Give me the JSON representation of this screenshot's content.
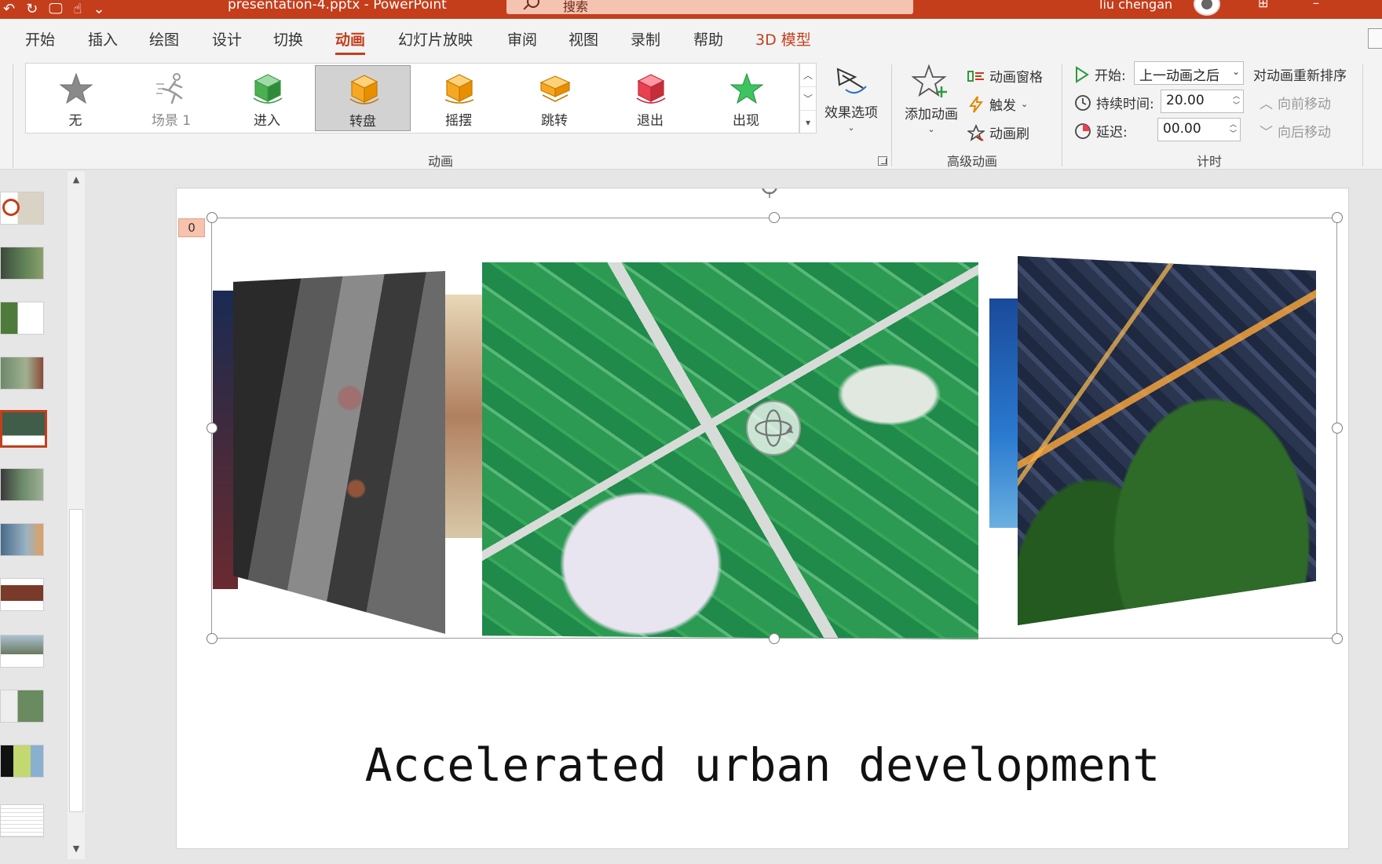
{
  "titlebar": {
    "document": "presentation-4.pptx - PowerPoint",
    "search_placeholder": "搜索",
    "user": "liu chengan"
  },
  "tabs": [
    {
      "label": "开始"
    },
    {
      "label": "插入"
    },
    {
      "label": "绘图"
    },
    {
      "label": "设计"
    },
    {
      "label": "切换"
    },
    {
      "label": "动画"
    },
    {
      "label": "幻灯片放映"
    },
    {
      "label": "审阅"
    },
    {
      "label": "视图"
    },
    {
      "label": "录制"
    },
    {
      "label": "帮助"
    },
    {
      "label": "3D 模型"
    }
  ],
  "animations": {
    "group_label": "动画",
    "items": [
      {
        "label": "无",
        "icon": "star-icon"
      },
      {
        "label": "场景 1",
        "icon": "running-person-icon"
      },
      {
        "label": "进入",
        "icon": "green-cube-icon"
      },
      {
        "label": "转盘",
        "icon": "orange-cube-icon"
      },
      {
        "label": "摇摆",
        "icon": "orange-cube-icon"
      },
      {
        "label": "跳转",
        "icon": "orange-cube-icon"
      },
      {
        "label": "退出",
        "icon": "red-cube-icon"
      },
      {
        "label": "出现",
        "icon": "green-star-icon"
      }
    ],
    "effect_options": "效果选项"
  },
  "advanced": {
    "group_label": "高级动画",
    "add_animation": "添加动画",
    "animation_pane": "动画窗格",
    "trigger": "触发",
    "animation_painter": "动画刷"
  },
  "timing": {
    "group_label": "计时",
    "start_label": "开始:",
    "start_value": "上一动画之后",
    "duration_label": "持续时间:",
    "duration_value": "20.00",
    "delay_label": "延迟:",
    "delay_value": "00.00",
    "reorder_label": "对动画重新排序",
    "move_earlier": "向前移动",
    "move_later": "向后移动"
  },
  "slide": {
    "animation_tag": "0",
    "caption": "Accelerated urban development"
  },
  "colors": {
    "accent": "#c43e1c"
  }
}
